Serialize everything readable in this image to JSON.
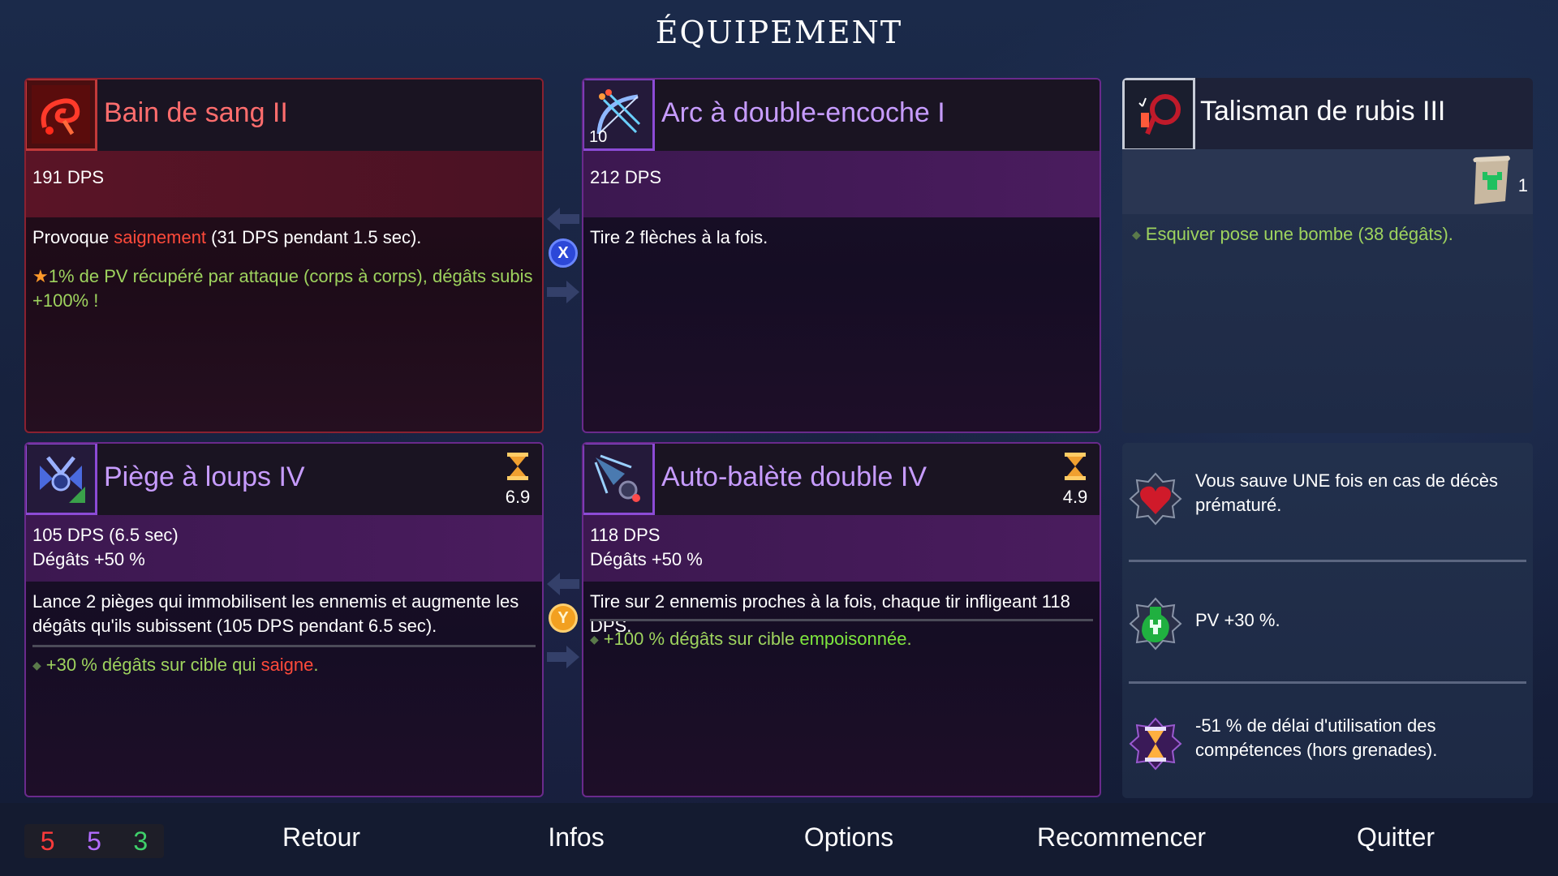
{
  "screen_title": "ÉQUIPEMENT",
  "weapons": [
    {
      "name": "Bain de sang II",
      "icon": "blood-whip-icon",
      "stats": [
        "191 DPS"
      ],
      "desc_pre": "Provoque ",
      "desc_keyword": "saignement",
      "desc_post": " (31 DPS pendant 1.5 sec).",
      "legendary_bonus": "1% de PV récupéré par attaque (corps à corps), dégâts subis +100% !"
    },
    {
      "name": "Arc à double-encoche I",
      "icon": "double-bow-icon",
      "level_badge": "10",
      "stats": [
        "212 DPS"
      ],
      "desc": "Tire 2 flèches à la fois."
    }
  ],
  "skills": [
    {
      "name": "Piège à loups IV",
      "icon": "wolf-trap-icon",
      "cooldown": "6.9",
      "stats": [
        "105 DPS (6.5 sec)",
        "Dégâts +50 %"
      ],
      "desc": "Lance 2 pièges qui immobilisent les ennemis et augmente les dégâts qu'ils subissent (105 DPS pendant 6.5 sec).",
      "bonus_pre": "+30 % dégâts sur cible qui ",
      "bonus_keyword": "saigne",
      "bonus_post": "."
    },
    {
      "name": "Auto-balète double IV",
      "icon": "double-crossbow-turret-icon",
      "cooldown": "4.9",
      "stats": [
        "118 DPS",
        "Dégâts +50 %"
      ],
      "desc": "Tire sur 2 ennemis proches à la fois, chaque tir infligeant 118 DPS.",
      "bonus_pre": "+100 % dégâts sur cible ",
      "bonus_keyword": "empoisonnée",
      "bonus_post": "."
    }
  ],
  "amulet": {
    "name": "Talisman de rubis III",
    "icon": "ruby-talisman-icon",
    "scroll_count": "1",
    "bonus": "Esquiver pose une bombe (38 dégâts)."
  },
  "mutations": [
    {
      "icon": "heart-mutation-icon",
      "text": "Vous sauve UNE fois en cas de décès prématuré."
    },
    {
      "icon": "health-potion-mutation-icon",
      "text": "PV +30 %."
    },
    {
      "icon": "hourglass-mutation-icon",
      "text": "-51 % de délai d'utilisation des compétences (hors grenades)."
    }
  ],
  "swap_buttons": {
    "weapons": "X",
    "skills": "Y"
  },
  "scrolls": {
    "brutality": "5",
    "tactics": "5",
    "survival": "3"
  },
  "menu": {
    "back": "Retour",
    "info": "Infos",
    "options": "Options",
    "restart": "Recommencer",
    "quit": "Quitter"
  },
  "colors": {
    "brutality": "#ff3b3b",
    "tactics": "#b26cff",
    "survival": "#3fd06a",
    "bleed_keyword": "#ff4a3a",
    "poison_keyword": "#7ee63e",
    "bonus_text": "#9ed35e"
  }
}
